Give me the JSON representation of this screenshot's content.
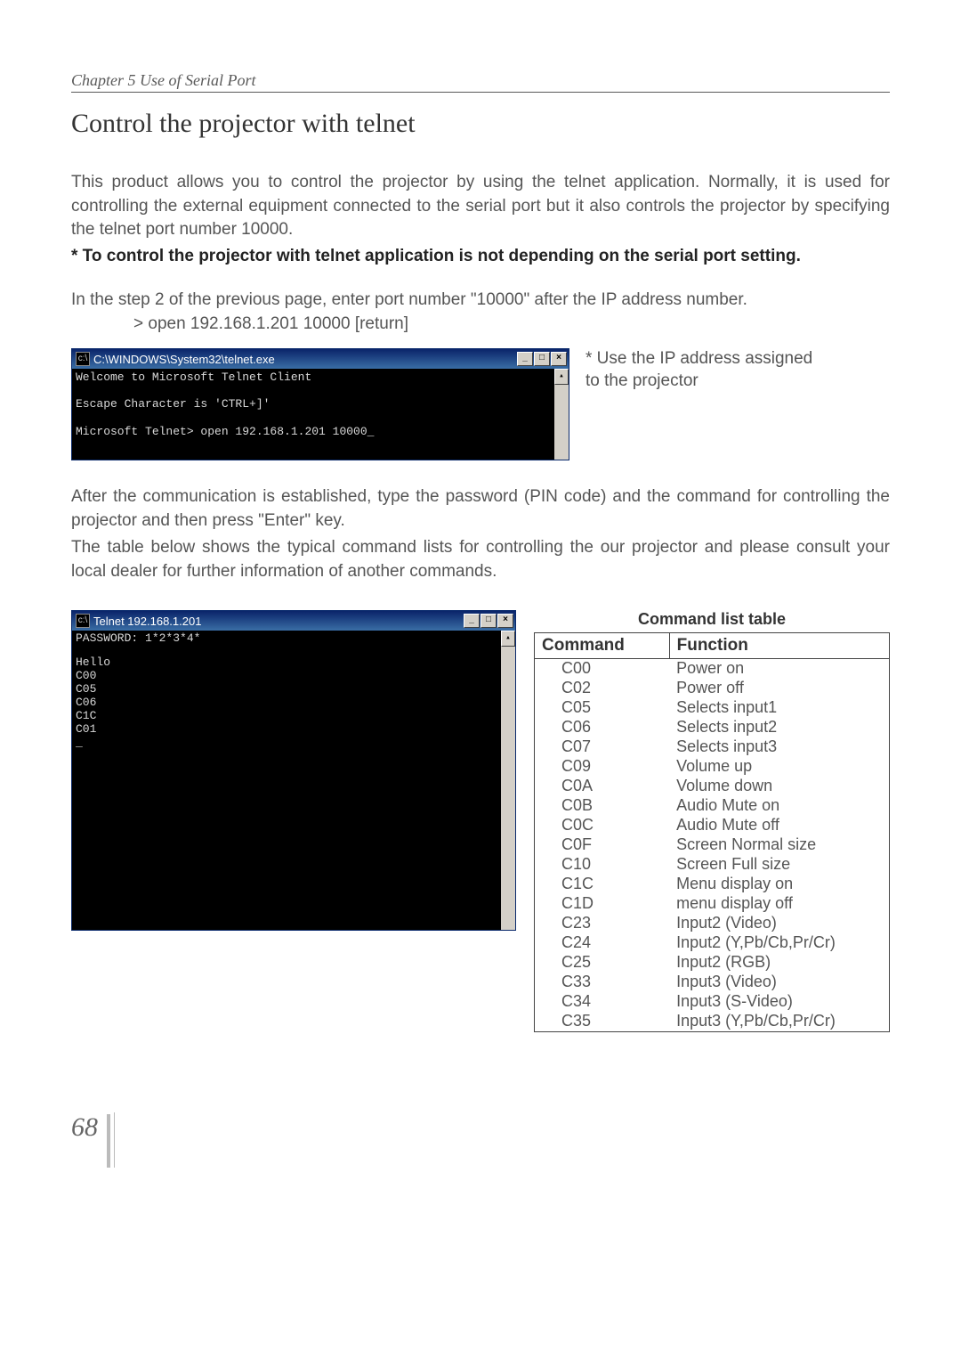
{
  "chapter_header": "Chapter 5 Use of Serial Port",
  "section_title": "Control the projector with telnet",
  "para1": "This product allows you to control the projector by using the telnet application. Normally, it is used for controlling the external equipment connected to the serial port but it also controls the projector by specifying the telnet port number 10000.",
  "bold_note": "* To control the projector with telnet application is not depending on the serial port setting.",
  "step_text": "In the step 2 of the previous page, enter port number \"10000\" after the IP address number.",
  "cmd_indent": "> open 192.168.1.201 10000 [return]",
  "term1": {
    "title": "C:\\WINDOWS\\System32\\telnet.exe",
    "line1": "Welcome to Microsoft Telnet Client",
    "line2": "Escape Character is 'CTRL+]'",
    "line3": "Microsoft Telnet> open 192.168.1.201 10000_"
  },
  "side_note": "* Use the IP address assigned to the projector",
  "para2": "After the communication is established, type the password (PIN code) and the command for controlling the projector and then press \"Enter\" key.",
  "para3": "The table below shows the typical command lists for controlling the our projector and please consult your local dealer for further information of another commands.",
  "term2": {
    "title": "Telnet 192.168.1.201",
    "lines": [
      "PASSWORD: 1*2*3*4*",
      "Hello",
      "C00",
      "C05",
      "C06",
      "C1C",
      "C01",
      "_"
    ]
  },
  "table_caption": "Command list table",
  "table_head_cmd": "Command",
  "table_head_fn": "Function",
  "commands": [
    {
      "c": "C00",
      "f": "Power on"
    },
    {
      "c": "C02",
      "f": "Power off"
    },
    {
      "c": "C05",
      "f": "Selects input1"
    },
    {
      "c": "C06",
      "f": "Selects input2"
    },
    {
      "c": "C07",
      "f": "Selects input3"
    },
    {
      "c": "C09",
      "f": "Volume up"
    },
    {
      "c": "C0A",
      "f": "Volume down"
    },
    {
      "c": "C0B",
      "f": "Audio Mute on"
    },
    {
      "c": "C0C",
      "f": "Audio Mute off"
    },
    {
      "c": "C0F",
      "f": "Screen Normal size"
    },
    {
      "c": "C10",
      "f": "Screen Full size"
    },
    {
      "c": "C1C",
      "f": "Menu display on"
    },
    {
      "c": "C1D",
      "f": "menu display off"
    },
    {
      "c": "C23",
      "f": "Input2 (Video)"
    },
    {
      "c": "C24",
      "f": "Input2 (Y,Pb/Cb,Pr/Cr)"
    },
    {
      "c": "C25",
      "f": "Input2 (RGB)"
    },
    {
      "c": "C33",
      "f": "Input3 (Video)"
    },
    {
      "c": "C34",
      "f": "Input3 (S-Video)"
    },
    {
      "c": "C35",
      "f": "Input3 (Y,Pb/Cb,Pr/Cr)"
    }
  ],
  "win_btn_min": "_",
  "win_btn_max": "□",
  "win_btn_close": "×",
  "scroll_up": "▴",
  "page_number": "68"
}
